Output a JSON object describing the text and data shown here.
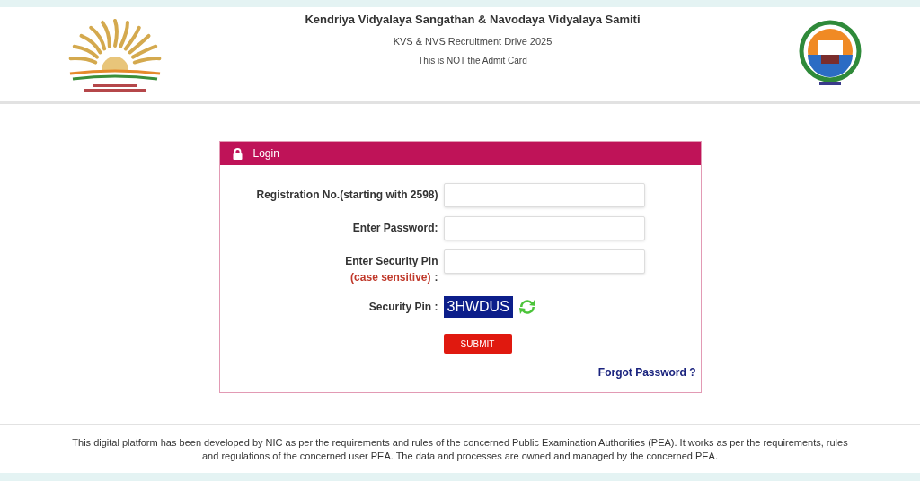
{
  "header": {
    "title": "Kendriya Vidyalaya Sangathan & Navodaya Vidyalaya Samiti",
    "subtitle": "KVS & NVS Recruitment Drive 2025",
    "notice": "This is NOT the Admit Card"
  },
  "login": {
    "title": "Login",
    "fields": [
      {
        "label": "Registration No.(starting with 2598)"
      },
      {
        "label": "Enter Password:"
      },
      {
        "label": "Enter Security Pin",
        "note": "(case sensitive)",
        "suffix": ":"
      }
    ],
    "captcha_label": "Security Pin :",
    "captcha": "3HWDUS",
    "submit": "SUBMIT",
    "forgot": "Forgot Password ?"
  },
  "footer": "This digital platform has been developed by NIC as per the requirements and rules of the concerned Public Examination Authorities (PEA). It works as per the requirements, rules and regulations of the concerned user PEA. The data and processes are owned and managed by the concerned PEA."
}
